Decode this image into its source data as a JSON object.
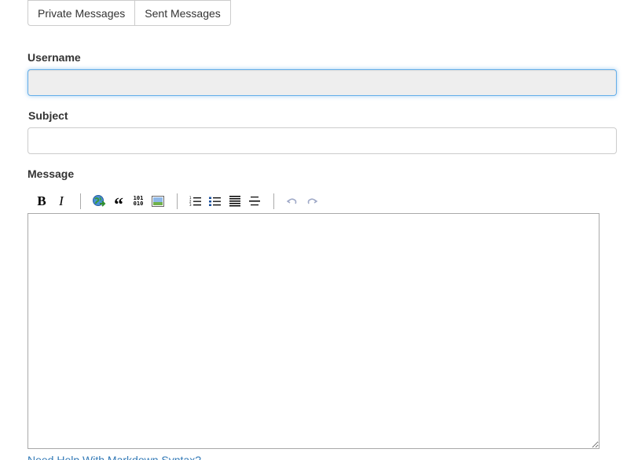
{
  "tabs": {
    "private_messages": "Private Messages",
    "sent_messages": "Sent Messages"
  },
  "form": {
    "username_label": "Username",
    "username_value": "",
    "subject_label": "Subject",
    "subject_value": "",
    "message_label": "Message",
    "message_value": ""
  },
  "toolbar": {
    "bold": "B",
    "italic": "I",
    "quote": "“",
    "code_top": "101",
    "code_bottom": "010",
    "icons": [
      "bold-icon",
      "italic-icon",
      "link-icon",
      "quote-icon",
      "code-icon",
      "image-icon",
      "numbered-list-icon",
      "bulleted-list-icon",
      "heading-icon",
      "horizontal-rule-icon",
      "undo-icon",
      "redo-icon"
    ]
  },
  "help_link": "Need Help With Markdown Syntax?",
  "colors": {
    "accent": "#66afe9",
    "link": "#337ab7",
    "border": "#cccccc"
  }
}
